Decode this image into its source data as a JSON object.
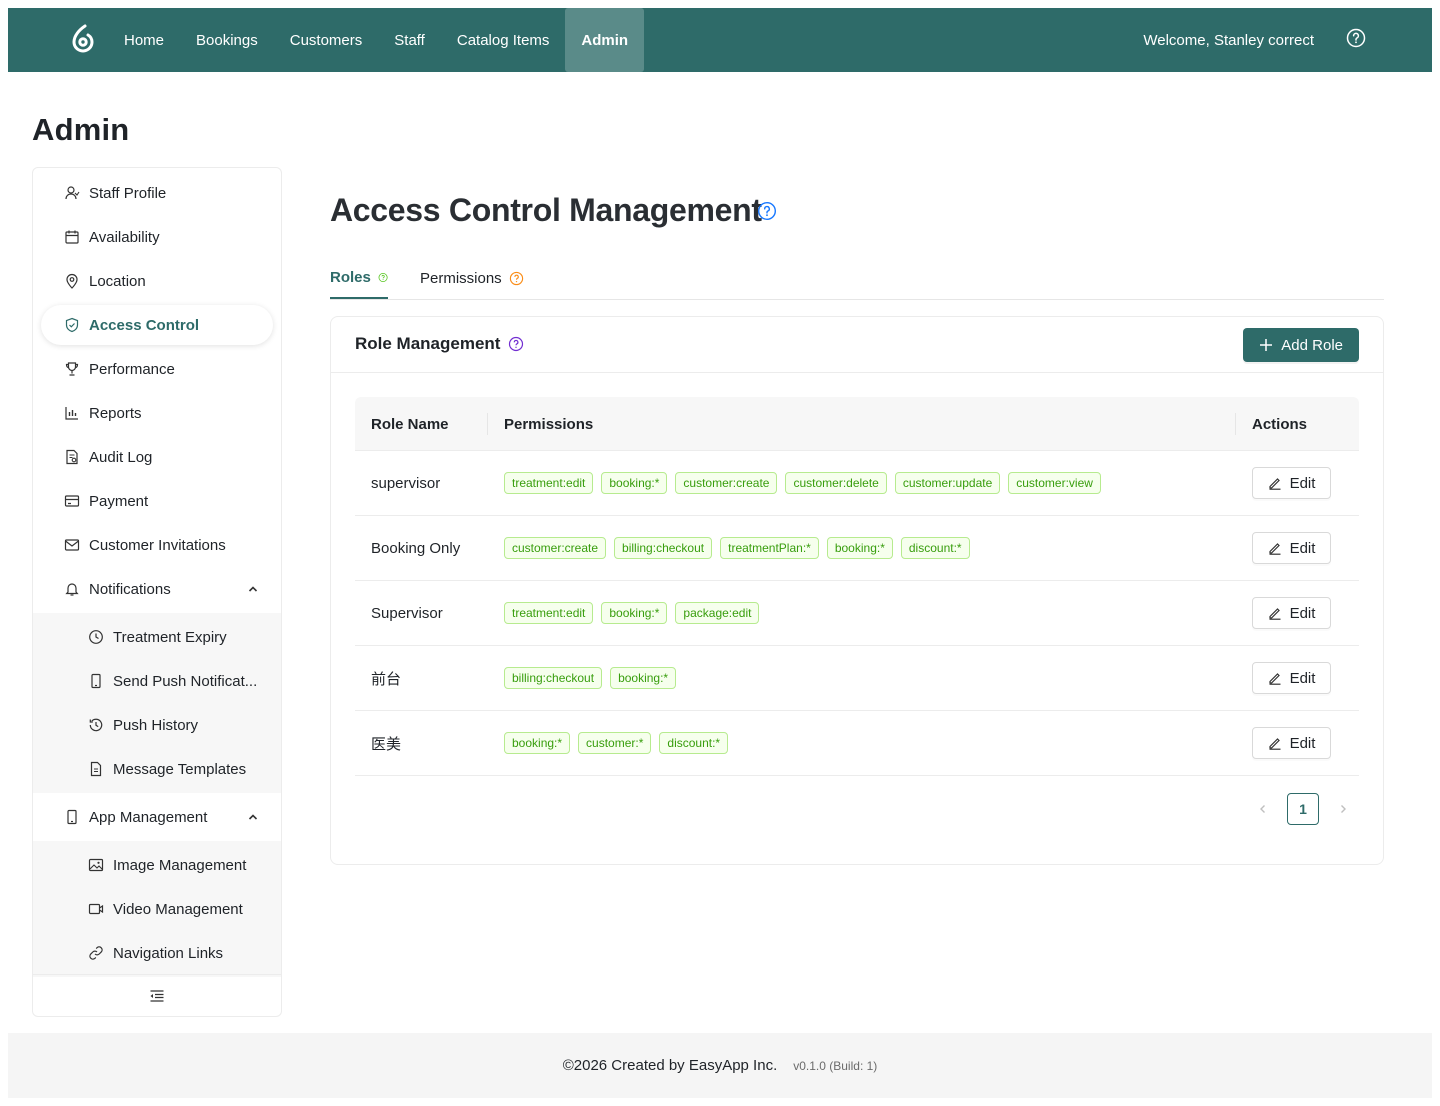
{
  "topbar": {
    "nav": [
      "Home",
      "Bookings",
      "Customers",
      "Staff",
      "Catalog Items",
      "Admin"
    ],
    "active_nav": "Admin",
    "welcome": "Welcome, Stanley correct",
    "brand_color": "#2e6b69"
  },
  "page": {
    "title": "Admin"
  },
  "sidebar": {
    "items": [
      {
        "label": "Staff Profile",
        "icon": "user-icon"
      },
      {
        "label": "Availability",
        "icon": "calendar-icon"
      },
      {
        "label": "Location",
        "icon": "location-pin-icon"
      },
      {
        "label": "Access Control",
        "icon": "shield-icon",
        "active": true
      },
      {
        "label": "Performance",
        "icon": "trophy-icon"
      },
      {
        "label": "Reports",
        "icon": "bar-chart-icon"
      },
      {
        "label": "Audit Log",
        "icon": "audit-icon"
      },
      {
        "label": "Payment",
        "icon": "credit-card-icon"
      },
      {
        "label": "Customer Invitations",
        "icon": "mail-icon"
      },
      {
        "label": "Notifications",
        "icon": "bell-icon",
        "expanded": true
      }
    ],
    "notifications_sub": [
      {
        "label": "Treatment Expiry",
        "icon": "clock-icon"
      },
      {
        "label": "Send Push Notificat...",
        "icon": "mobile-icon"
      },
      {
        "label": "Push History",
        "icon": "history-icon"
      },
      {
        "label": "Message Templates",
        "icon": "file-icon"
      }
    ],
    "app_management": {
      "label": "App Management",
      "icon": "mobile-icon",
      "expanded": true
    },
    "app_sub": [
      {
        "label": "Image Management",
        "icon": "image-icon"
      },
      {
        "label": "Video Management",
        "icon": "video-icon"
      },
      {
        "label": "Navigation Links",
        "icon": "link-icon"
      }
    ]
  },
  "main": {
    "title": "Access Control Management",
    "tabs": [
      {
        "label": "Roles",
        "active": true
      },
      {
        "label": "Permissions"
      }
    ],
    "card": {
      "title": "Role Management",
      "add_button": "Add Role"
    },
    "table": {
      "headers": [
        "Role Name",
        "Permissions",
        "Actions"
      ],
      "edit_label": "Edit",
      "rows": [
        {
          "name": "supervisor",
          "permissions": [
            "treatment:edit",
            "booking:*",
            "customer:create",
            "customer:delete",
            "customer:update",
            "customer:view"
          ]
        },
        {
          "name": "Booking Only",
          "permissions": [
            "customer:create",
            "billing:checkout",
            "treatmentPlan:*",
            "booking:*",
            "discount:*"
          ]
        },
        {
          "name": "Supervisor",
          "permissions": [
            "treatment:edit",
            "booking:*",
            "package:edit"
          ]
        },
        {
          "name": "前台",
          "permissions": [
            "billing:checkout",
            "booking:*"
          ]
        },
        {
          "name": "医美",
          "permissions": [
            "booking:*",
            "customer:*",
            "discount:*"
          ]
        }
      ]
    },
    "pagination": {
      "current": "1"
    }
  },
  "footer": {
    "copyright": "©2026 Created by EasyApp Inc.",
    "version": "v0.1.0 (Build: 1)"
  }
}
